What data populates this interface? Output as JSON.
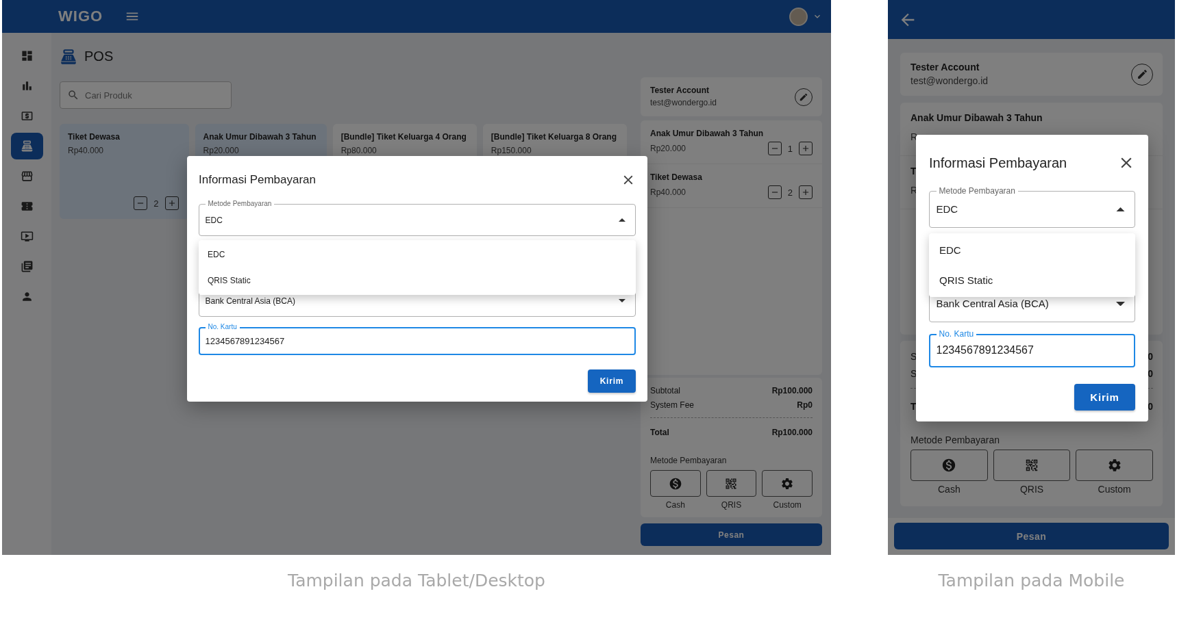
{
  "desktop": {
    "caption": "Tampilan pada Tablet/Desktop",
    "logo": "WIGO",
    "sidebar": [
      {
        "selected": false
      },
      {
        "selected": false
      },
      {
        "selected": false
      },
      {
        "selected": true
      },
      {
        "selected": false
      },
      {
        "selected": false
      },
      {
        "selected": false
      },
      {
        "selected": false
      },
      {
        "selected": false
      }
    ],
    "page_title": "POS",
    "search": {
      "placeholder": "Cari Produk"
    },
    "products": [
      {
        "name": "Tiket Dewasa",
        "price": "Rp40.000",
        "selected": true,
        "quantity": "2"
      },
      {
        "name": "Anak Umur Dibawah 3 Tahun",
        "price": "Rp20.000",
        "selected": true
      },
      {
        "name": "[Bundle] Tiket Keluarga 4 Orang",
        "price": "Rp80.000",
        "selected": false
      },
      {
        "name": "[Bundle] Tiket Keluarga 8 Orang",
        "price": "Rp150.000",
        "selected": false
      }
    ],
    "account": {
      "name": "Tester Account",
      "email": "test@wondergo.id"
    },
    "cart": [
      {
        "name": "Anak Umur Dibawah 3 Tahun",
        "price": "Rp20.000",
        "quantity": "1"
      },
      {
        "name": "Tiket Dewasa",
        "price": "Rp40.000",
        "quantity": "2"
      }
    ],
    "summary": [
      {
        "label": "Subtotal",
        "value": "Rp100.000"
      },
      {
        "label": "System Fee",
        "value": "Rp0"
      }
    ],
    "total": {
      "label": "Total",
      "value": "Rp100.000"
    },
    "payment": {
      "label": "Metode Pembayaran",
      "options": [
        {
          "kind": "cash",
          "label": "Cash"
        },
        {
          "kind": "qris",
          "label": "QRIS"
        },
        {
          "kind": "custom",
          "label": "Custom"
        }
      ]
    },
    "order_button": "Pesan",
    "modal": {
      "title": "Informasi Pembayaran",
      "method": {
        "label": "Metode Pembayaran",
        "value": "EDC",
        "open": true
      },
      "menu": [
        "EDC",
        "QRIS Static"
      ],
      "bank": {
        "value": "Bank Central Asia (BCA)"
      },
      "card": {
        "label": "No. Kartu",
        "value": "1234567891234567",
        "focused": true
      },
      "submit": "Kirim"
    }
  },
  "mobile": {
    "caption": "Tampilan pada Mobile",
    "account": {
      "name": "Tester Account",
      "email": "test@wondergo.id"
    },
    "cart": [
      {
        "name": "Anak Umur Dibawah 3 Tahun",
        "price": "R"
      },
      {
        "name": "T",
        "price": "R"
      }
    ],
    "summary": [
      {
        "label": "S",
        "value": "0"
      },
      {
        "label": "S",
        "value": "0"
      }
    ],
    "total": {
      "label": "T",
      "value": "0"
    },
    "payment": {
      "label": "Metode Pembayaran",
      "options": [
        {
          "kind": "cash",
          "label": "Cash"
        },
        {
          "kind": "qris",
          "label": "QRIS"
        },
        {
          "kind": "custom",
          "label": "Custom"
        }
      ]
    },
    "order_button": "Pesan",
    "modal": {
      "title": "Informasi Pembayaran",
      "method": {
        "label": "Metode Pembayaran",
        "value": "EDC",
        "open": true
      },
      "menu": [
        "EDC",
        "QRIS Static"
      ],
      "bank": {
        "value": "Bank Central Asia (BCA)"
      },
      "card": {
        "label": "No. Kartu",
        "value": "1234567891234567",
        "focused": true
      },
      "submit": "Kirim"
    }
  }
}
